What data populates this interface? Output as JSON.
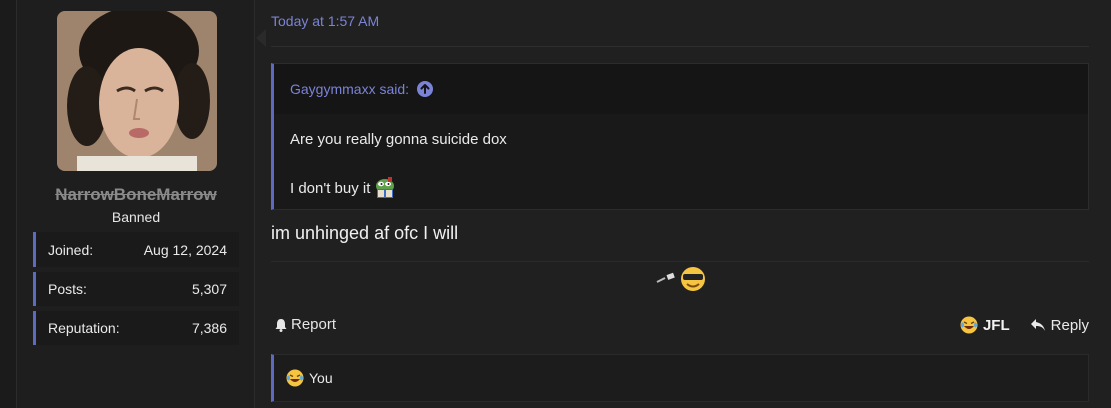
{
  "user": {
    "name": "NarrowBoneMarrow",
    "title": "Banned",
    "stats": [
      {
        "label": "Joined:",
        "value": "Aug 12, 2024"
      },
      {
        "label": "Posts:",
        "value": "5,307"
      },
      {
        "label": "Reputation:",
        "value": "7,386"
      }
    ]
  },
  "post": {
    "date": "Today at 1:57 AM",
    "quote": {
      "author_line": "Gaygymmaxx said:",
      "line1": "Are you really gonna suicide dox",
      "line2": "I don't buy it"
    },
    "message": "im unhinged af ofc I will"
  },
  "actions": {
    "report_label": "Report",
    "jfl_label": "JFL",
    "reply_label": "Reply"
  },
  "reactions": {
    "summary": "You"
  },
  "colors": {
    "accent": "#5c6bc0",
    "link": "#7b83d6"
  }
}
